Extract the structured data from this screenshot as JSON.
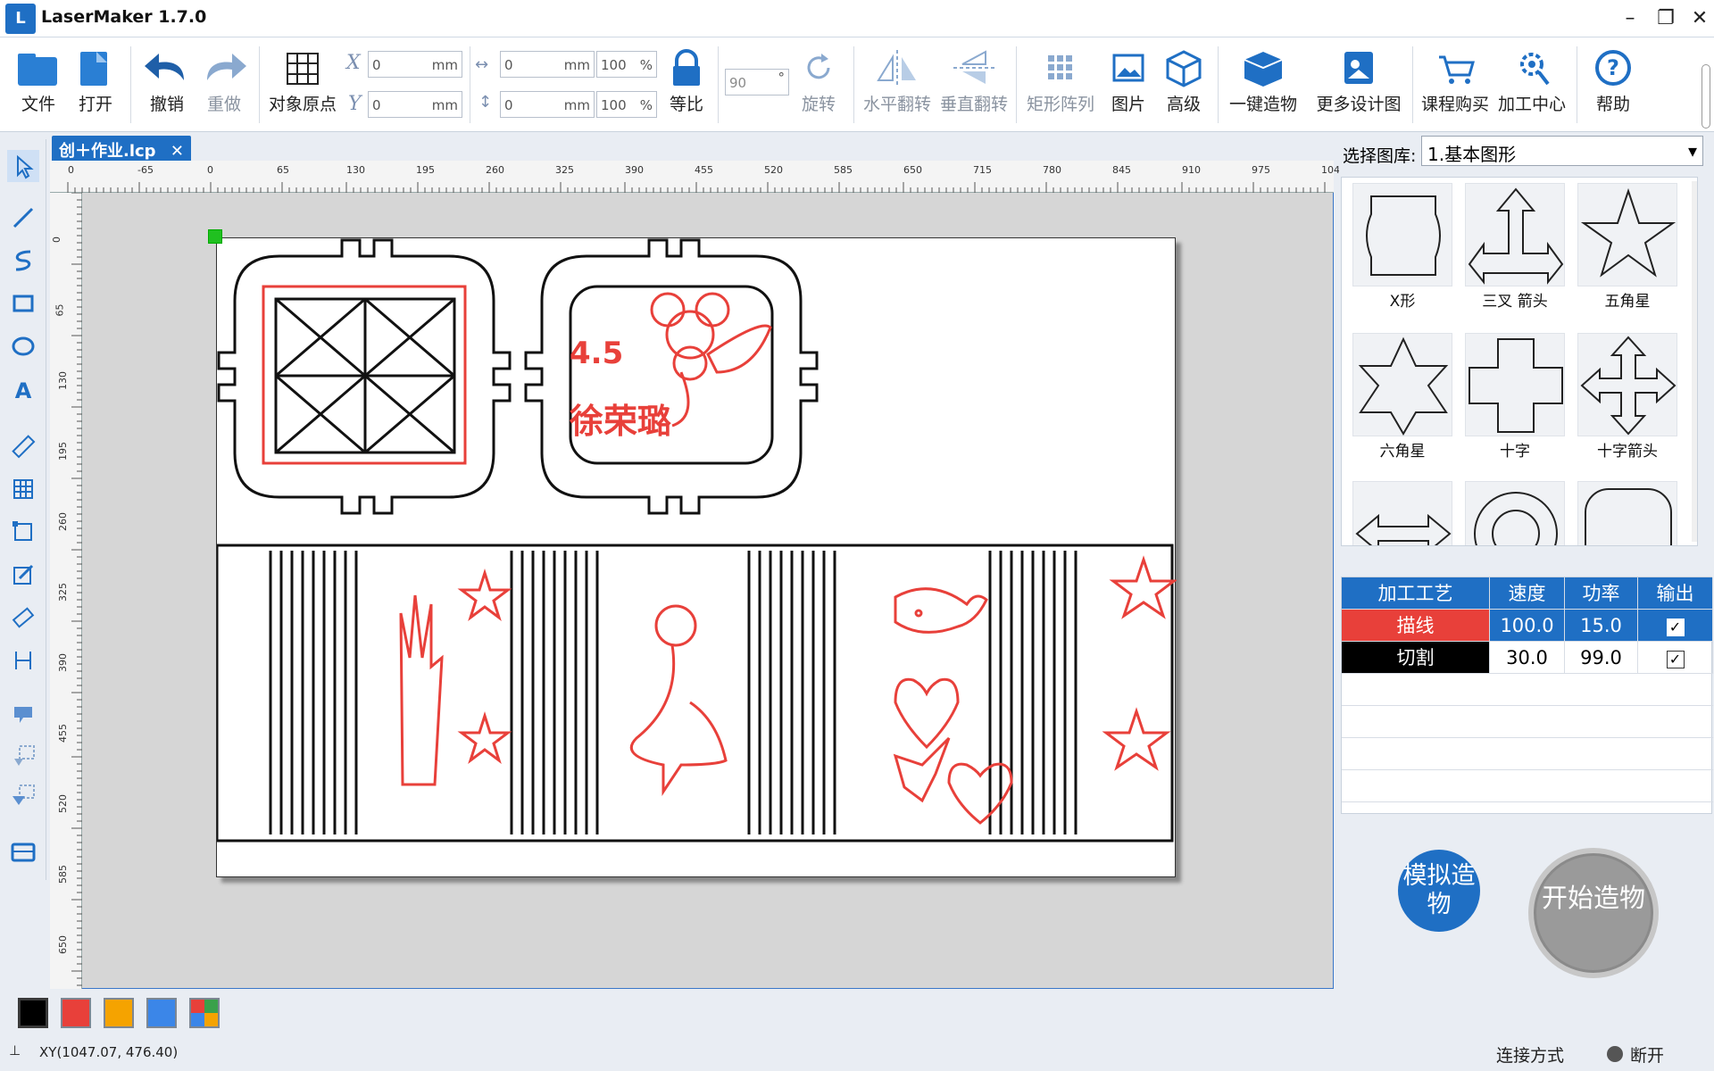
{
  "app": {
    "title": "LaserMaker 1.7.0",
    "logo_text": "L"
  },
  "toolbar": {
    "file": "文件",
    "open": "打开",
    "undo": "撤销",
    "redo": "重做",
    "origin": "对象原点",
    "x_label": "X",
    "y_label": "Y",
    "x_value": "0",
    "y_value": "0",
    "w_value": "0",
    "h_value": "0",
    "w_pct": "100",
    "h_pct": "100",
    "unit_mm": "mm",
    "unit_pct": "%",
    "lock_ratio": "等比",
    "angle_value": "90",
    "angle_unit": "°",
    "rotate": "旋转",
    "hflip": "水平翻转",
    "vflip": "垂直翻转",
    "array": "矩形阵列",
    "image": "图片",
    "advanced": "高级",
    "oneclick": "一键造物",
    "more_designs": "更多设计图",
    "purchase": "课程购买",
    "process_center": "加工中心",
    "help": "帮助"
  },
  "document": {
    "tab_label": "创＋作业.lcp",
    "close": "✕"
  },
  "canvas": {
    "ruler_h": [
      "0",
      "-65",
      "0",
      "65",
      "130",
      "195",
      "260",
      "325",
      "390",
      "455",
      "520",
      "585",
      "650",
      "715",
      "780",
      "845",
      "910",
      "975",
      "104"
    ],
    "ruler_v": [
      "0",
      "65",
      "130",
      "195",
      "260",
      "325",
      "390",
      "455",
      "520",
      "585",
      "650"
    ],
    "text_number": "4.5",
    "text_name": "徐荣璐"
  },
  "library": {
    "label": "选择图库:",
    "selected": "1.基本图形",
    "shapes": [
      "X形",
      "三叉 箭头",
      "五角星",
      "六角星",
      "十字",
      "十字箭头"
    ]
  },
  "process_table": {
    "headers": [
      "加工工艺",
      "速度",
      "功率",
      "输出"
    ],
    "rows": [
      {
        "name": "描线",
        "speed": "100.0",
        "power": "15.0",
        "output": "✓",
        "color": "#e8403a"
      },
      {
        "name": "切割",
        "speed": "30.0",
        "power": "99.0",
        "output": "✓",
        "color": "#000000"
      }
    ]
  },
  "buttons": {
    "simulate": "模拟造物",
    "start": "开始造物"
  },
  "palette": [
    "#000000",
    "#e8403a",
    "#f5a300",
    "#3b86e8",
    "multi"
  ],
  "status": {
    "coords": "XY(1047.07, 476.40)",
    "connection_label": "连接方式",
    "connection_state": "断开"
  },
  "colors": {
    "accent": "#1f6fc4",
    "engrave": "#e8403a",
    "cut": "#000000"
  }
}
